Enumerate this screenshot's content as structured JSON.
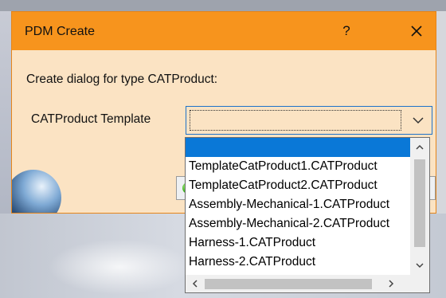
{
  "dialog": {
    "title": "PDM Create",
    "help_label": "?",
    "prompt": "Create dialog for type CATProduct:",
    "template_label": "CATProduct Template",
    "template_value": ""
  },
  "dropdown": {
    "selected_option": "",
    "options": [
      "TemplateCatProduct1.CATProduct",
      "TemplateCatProduct2.CATProduct",
      "Assembly-Mechanical-1.CATProduct",
      "Assembly-Mechanical-2.CATProduct",
      "Harness-1.CATProduct",
      "Harness-2.CATProduct"
    ]
  },
  "colors": {
    "titlebar": "#f7941d",
    "dialog_body": "#fbe3c3",
    "selection": "#0a78d7"
  }
}
